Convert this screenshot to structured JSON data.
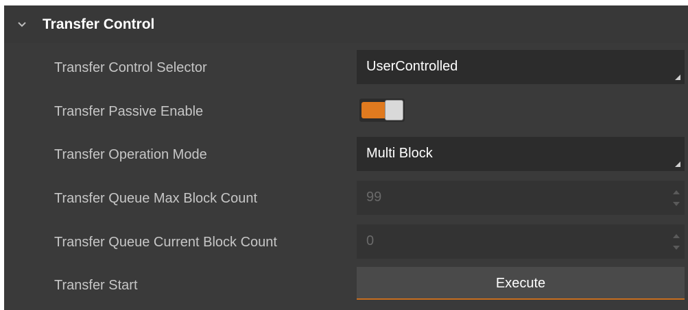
{
  "section": {
    "title": "Transfer Control",
    "expand_icon": "chevron-down-icon"
  },
  "rows": {
    "selector": {
      "label": "Transfer Control Selector",
      "value": "UserControlled"
    },
    "passive_enable": {
      "label": "Transfer Passive Enable",
      "state": "on"
    },
    "operation_mode": {
      "label": "Transfer Operation Mode",
      "value": "Multi Block"
    },
    "queue_max": {
      "label": "Transfer Queue Max Block Count",
      "value": "99"
    },
    "queue_current": {
      "label": "Transfer Queue Current Block Count",
      "value": "0"
    },
    "start": {
      "label": "Transfer Start",
      "button": "Execute"
    }
  },
  "colors": {
    "panel": "#3a3a3a",
    "field": "#2c2c2c",
    "accent": "#e07a1f",
    "label": "#c6c6c6"
  }
}
